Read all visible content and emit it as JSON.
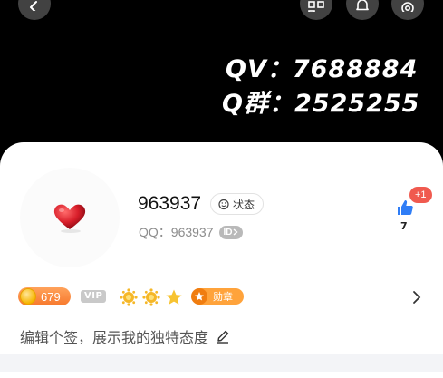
{
  "nav": {
    "back_icon": "chevron-left-icon",
    "qr_icon": "qr-code-icon",
    "bell_icon": "bell-icon",
    "settings_icon": "gear-icon"
  },
  "banner": {
    "line1": "QV：7688884",
    "line2": "Q群：2525255"
  },
  "profile": {
    "avatar_icon": "heart-icon",
    "name": "963937",
    "status_label": "状态",
    "qq_line": "QQ：963937",
    "id_badge": "ID",
    "like_increment": "+1",
    "like_count": "7"
  },
  "badges": {
    "level": "679",
    "vip": "VIP",
    "medal_label": "勋章"
  },
  "signature": {
    "text": "编辑个签，展示我的独特态度"
  },
  "colors": {
    "like_badge": "#f05a4f",
    "level_pill": "#f7792d",
    "medal": "#ffa33b",
    "heart": "#d81e2a"
  }
}
